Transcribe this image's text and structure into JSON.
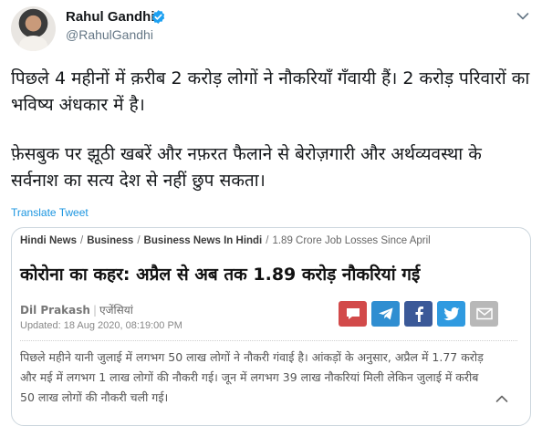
{
  "tweet": {
    "author_name": "Rahul Gandhi",
    "author_handle": "@RahulGandhi",
    "paragraph1": "पिछले 4 महीनों में क़रीब 2 करोड़ लोगों ने नौकरियाँ गँवायी हैं। 2 करोड़ परिवारों का भविष्य अंधकार में है।",
    "paragraph2": "फ़ेसबुक पर झूठी खबरें और नफ़रत फैलाने से बेरोज़गारी और अर्थव्यवस्था के सर्वनाश का सत्य देश से नहीं छुप सकता।",
    "translate_label": "Translate Tweet"
  },
  "card": {
    "breadcrumbs": [
      "Hindi News",
      "Business",
      "Business News In Hindi"
    ],
    "breadcrumb_current": "1.89 Crore Job Losses Since April",
    "breadcrumb_separator": "/",
    "headline": "कोरोना का कहर: अप्रैल से अब तक 1.89 करोड़ नौकरियां गई",
    "author": "Dil Prakash",
    "author_separator": "|",
    "agency": "एजेंसियां",
    "updated": "Updated: 18 Aug 2020, 08:19:00 PM",
    "summary": "पिछले महीने यानी जुलाई में लगभग 50 लाख लोगों ने नौकरी गंवाई है। आंकड़ों के अनुसार, अप्रैल में 1.77 करोड़ और मई में लगभग 1 लाख लोगों की नौकरी गई। जून में लगभग 39 लाख नौकरियां मिली लेकिन जुलाई में करीब 50 लाख लोगों की नौकरी चली गई।",
    "share_buttons": [
      "comment-icon",
      "telegram-icon",
      "facebook-icon",
      "twitter-icon",
      "mail-icon"
    ]
  },
  "colors": {
    "link_blue": "#1b95e0",
    "verified_blue": "#1da1f2",
    "handle_gray": "#657786",
    "comment_red": "#d24a4a",
    "telegram_blue": "#2f8ed1",
    "facebook_blue": "#3b5998",
    "twitter_blue": "#2f9ae0",
    "mail_gray": "#b8b8b8"
  }
}
